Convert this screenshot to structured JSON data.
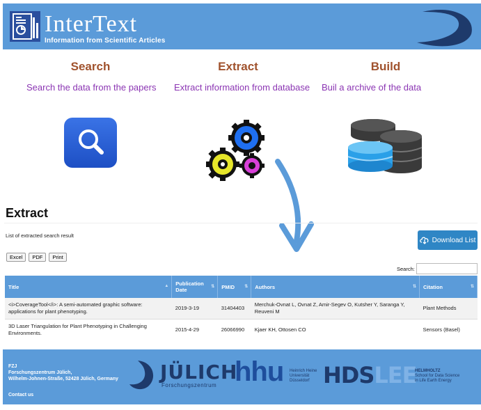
{
  "header": {
    "title": "InterText",
    "subtitle": "Information from Scientific Articles"
  },
  "features": [
    {
      "title": "Search",
      "description": "Search the data from the papers"
    },
    {
      "title": "Extract",
      "description": "Extract information from database"
    },
    {
      "title": "Build",
      "description": "Buil a archive of the data"
    }
  ],
  "extract": {
    "title": "Extract",
    "subtitle": "List of extracted search result",
    "download_label": "Download List",
    "buttons": {
      "excel": "Excel",
      "pdf": "PDF",
      "print": "Print"
    },
    "search_label": "Search:",
    "search_value": ""
  },
  "table": {
    "headers": {
      "title": "Title",
      "date": "Publication Date",
      "pmid": "PMID",
      "authors": "Authors",
      "citation": "Citation"
    },
    "rows": [
      {
        "title": "<i>CoverageTool</i>: A semi-automated graphic software: applications for plant phenotyping.",
        "date": "2019-3-19",
        "pmid": "31404403",
        "authors": "Merchuk-Ovnat L, Ovnat Z, Amir-Segev O, Kutsher Y, Saranga Y, Reuveni M",
        "citation": "Plant Methods"
      },
      {
        "title": "3D Laser Triangulation for Plant Phenotyping in Challenging Environments.",
        "date": "2015-4-29",
        "pmid": "26066990",
        "authors": "Kjaer KH, Ottosen CO",
        "citation": "Sensors (Basel)"
      }
    ]
  },
  "footer": {
    "org": "FZJ",
    "org_full": "Forschungszentrum Jülich,",
    "address": "Wilhelm-Johnen-Straße, 52428 Jülich, Germany",
    "contact": "Contact us",
    "julich": "JÜLICH",
    "julich_sub": "Forschungszentrum",
    "hhu": "hhu",
    "hhu_line1": "Heinrich Heine",
    "hhu_line2": "Universität",
    "hhu_line3": "Düsseldorf",
    "hds": "HDS",
    "lee": "LEE",
    "helm_line1": "HELMHOLTZ",
    "helm_line2": "School for Data Science",
    "helm_line3": "in Life Earth Energy"
  },
  "colors": {
    "header_blue": "#5b9bd9",
    "feature_title": "#a0522d",
    "feature_text": "#8b35b3",
    "button_blue": "#2f86c5"
  },
  "icons": [
    "document-chart-icon",
    "swoosh-logo-icon",
    "magnifier-icon",
    "gears-icon",
    "database-icon",
    "arrow-down-icon",
    "cloud-download-icon",
    "sort-icon"
  ]
}
